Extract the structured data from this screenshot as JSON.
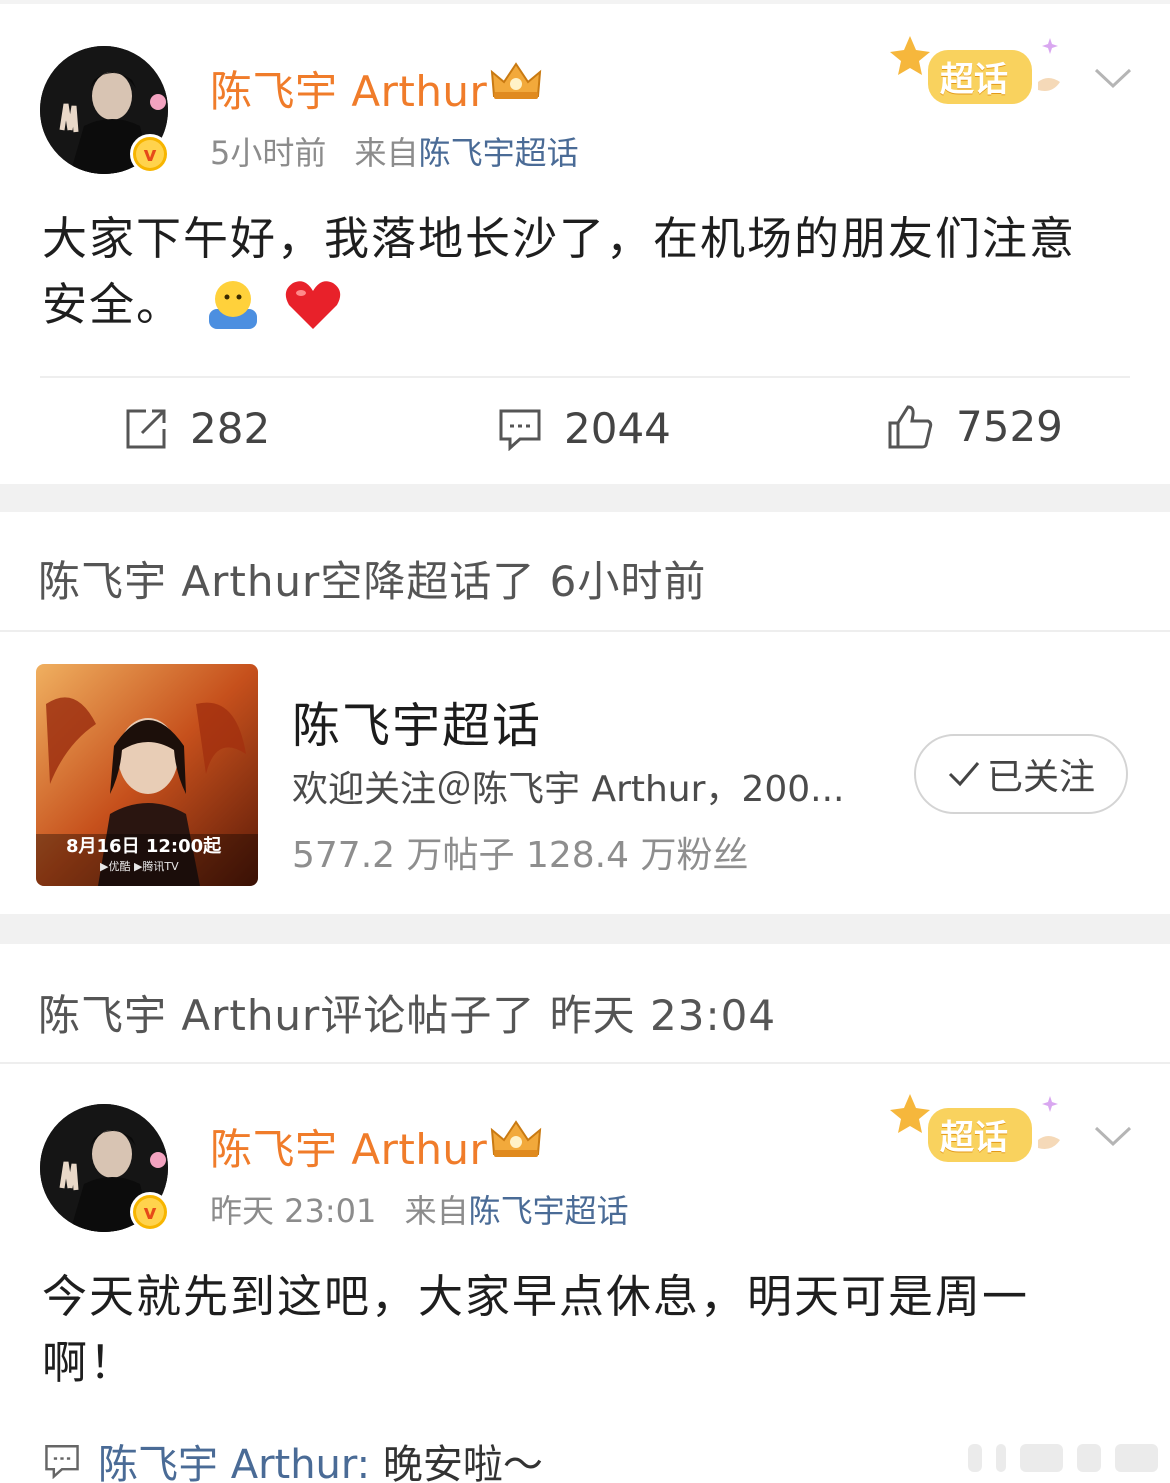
{
  "post1": {
    "username": "陈飞宇 Arthur",
    "time": "5小时前",
    "source_prefix": "来自",
    "source": "陈飞宇超话",
    "text_line1": "大家下午好，我落地长沙了，在机场的朋友们注意",
    "text_line2": "安全。",
    "emojis": [
      "child-emoji-icon",
      "red-heart-icon"
    ],
    "badge_label": "超话",
    "repost_count": "282",
    "comment_count": "2044",
    "like_count": "7529"
  },
  "activity1": {
    "title": "陈飞宇 Arthur空降超话了 6小时前"
  },
  "topic": {
    "name": "陈飞宇超话",
    "description": "欢迎关注＠陈飞宇 Arthur，200...",
    "stats": "577.2 万帖子  128.4 万粉丝",
    "follow_label": "已关注",
    "cover_date": "8月16日 12:00起"
  },
  "activity2": {
    "title": "陈飞宇 Arthur评论帖子了 昨天 23:04"
  },
  "post2": {
    "username": "陈飞宇 Arthur",
    "time": "昨天 23:01",
    "source_prefix": "来自",
    "source": "陈飞宇超话",
    "text_line1": "今天就先到这吧，大家早点休息，明天可是周一",
    "text_line2": "啊！",
    "badge_label": "超话",
    "comment_author": "陈飞宇 Arthur:",
    "comment_text": "晚安啦～"
  },
  "colors": {
    "username": "#f07c2a",
    "link": "#4a6b96",
    "badge": "#f7b500",
    "separator": "#f1f1f1"
  }
}
